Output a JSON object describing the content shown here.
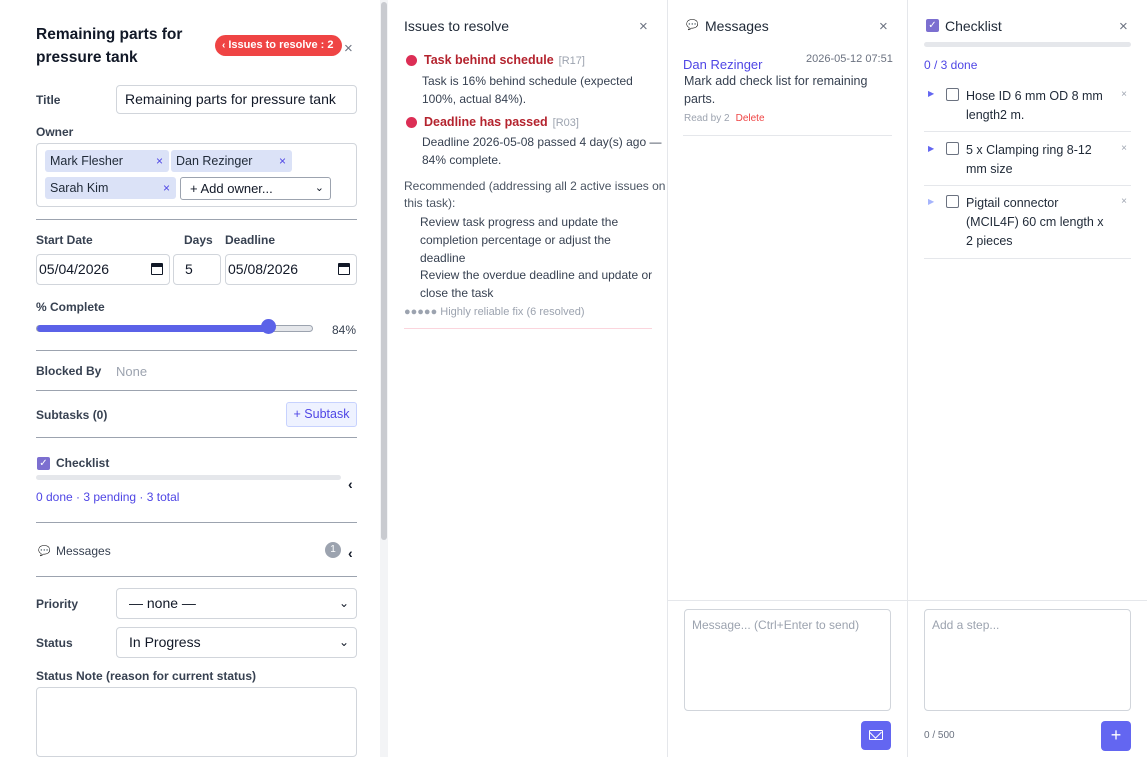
{
  "task": {
    "title_heading": "Remaining parts for pressure tank",
    "issues_badge": "Issues to resolve : 2",
    "title_label": "Title",
    "title_value": "Remaining parts for pressure tank",
    "owner_label": "Owner",
    "owners": [
      "Mark Flesher",
      "Dan Rezinger",
      "Sarah Kim"
    ],
    "add_owner": "+ Add owner...",
    "start_date_label": "Start Date",
    "start_date": "05/04/2026",
    "days_label": "Days",
    "days": "5",
    "deadline_label": "Deadline",
    "deadline": "05/08/2026",
    "complete_label": "% Complete",
    "complete_pct": 84,
    "complete_text": "84%",
    "blocked_label": "Blocked By",
    "blocked_value": "None",
    "subtasks_label": "Subtasks (0)",
    "subtask_button": "+ Subtask",
    "checklist_label": "Checklist",
    "checklist_summary": "0 done · 3 pending · 3 total",
    "checklist_progress": 0,
    "messages_label": "Messages",
    "messages_count": "1",
    "priority_label": "Priority",
    "priority_value": "— none —",
    "status_label": "Status",
    "status_value": "In Progress",
    "status_note_label": "Status Note (reason for current status)"
  },
  "issues": {
    "title": "Issues to resolve",
    "items": [
      {
        "title": "Task behind schedule",
        "code": "[R17]",
        "line1": "Task is 16% behind schedule (expected",
        "line2": "100%, actual 84%)."
      },
      {
        "title": "Deadline has passed",
        "code": "[R03]",
        "line1": "Deadline 2026-05-08 passed 4 day(s) ago —",
        "line2": "84% complete."
      }
    ],
    "recommended_line1": "Recommended (addressing all 2 active issues on",
    "recommended_line2": "this task):",
    "recommendations": [
      [
        "Review task progress and update the",
        "completion percentage or adjust the",
        "deadline"
      ],
      [
        "Review the overdue deadline and update or",
        "close the task"
      ]
    ],
    "reliability": "●●●●● Highly reliable fix (6 resolved)"
  },
  "messages": {
    "title": "Messages",
    "items": [
      {
        "author": "Dan Rezinger",
        "time": "2026-05-12 07:51",
        "body_line1": "Mark add check list for remaining",
        "body_line2": "parts.",
        "read_by": "Read by 2",
        "delete": "Delete"
      }
    ],
    "compose_placeholder": "Message... (Ctrl+Enter to send)"
  },
  "checklist": {
    "title": "Checklist",
    "progress_text": "0 / 3 done",
    "progress": 0,
    "items": [
      [
        "Hose ID 6 mm OD 8 mm",
        "length2 m."
      ],
      [
        "5 x Clamping ring 8-12",
        "mm size"
      ],
      [
        "Pigtail connector",
        "(MCIL4F) 60 cm length x",
        "2 pieces"
      ]
    ],
    "add_placeholder": "Add a step...",
    "char_counter": "0 / 500"
  },
  "colors": {
    "accent": "#6366f1",
    "danger": "#ef4444",
    "issue_title": "#b4232e"
  }
}
